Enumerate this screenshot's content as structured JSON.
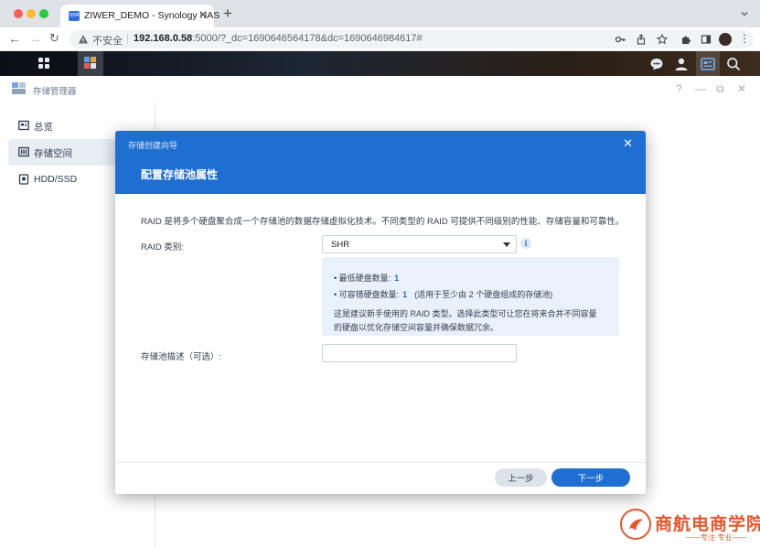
{
  "browser": {
    "tab_title": "ZIWER_DEMO - Synology NAS",
    "tab_favicon_text": "DSM",
    "new_tab": "+",
    "insecure_label": "不安全",
    "url_host": "192.168.0.58",
    "url_rest": ":5000/?_dc=1690646564178&dc=1690646984617#"
  },
  "app": {
    "title": "存储管理器",
    "help": "?",
    "minimize": "—",
    "restore": "⧉",
    "close": "✕"
  },
  "sidebar": {
    "items": [
      {
        "label": "总览"
      },
      {
        "label": "存储空间"
      },
      {
        "label": "HDD/SSD"
      }
    ]
  },
  "dialog": {
    "wizard_title": "存储创建向导",
    "close": "✕",
    "title": "配置存储池属性",
    "description": "RAID 是将多个硬盘聚合成一个存储池的数据存储虚拟化技术。不同类型的 RAID 可提供不同级别的性能、存储容量和可靠性。",
    "raid_label": "RAID 类别:",
    "raid_value": "SHR",
    "info_icon_text": "i",
    "min_disks_label": "最低硬盘数量:",
    "min_disks_value": "1",
    "fault_tolerance_label": "可容错硬盘数量:",
    "fault_tolerance_value": "1",
    "fault_tolerance_note": "(适用于至少由 2 个硬盘组成的存储池)",
    "recommend_line1": "这是建议新手使用的 RAID 类型。选择此类型可让您在将来合并不同容量",
    "recommend_line2": "的硬盘以优化存储空间容量并确保数据冗余。",
    "pool_desc_label": "存储池描述（可选）:",
    "pool_desc_value": "",
    "prev_button": "上一步",
    "next_button": "下一步"
  },
  "watermark": {
    "name": "商航电商学院",
    "slogan": "——专注·专业——"
  },
  "colors": {
    "accent": "#1e6fd1",
    "info_bg": "#e9f1fc",
    "watermark": "#e4572e"
  }
}
